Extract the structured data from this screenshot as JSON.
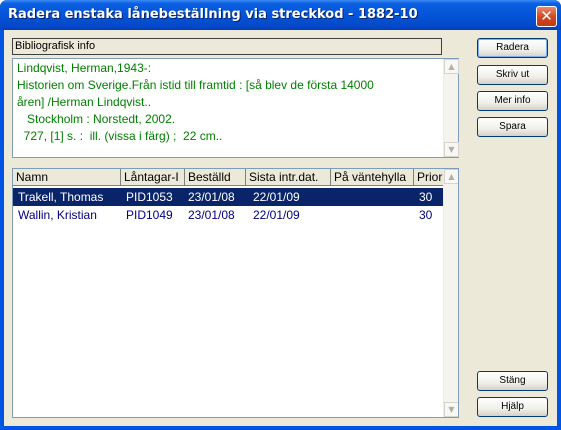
{
  "window": {
    "title": "Radera enstaka lånebeställning via streckkod - 1882-10",
    "close_glyph": "✕"
  },
  "bib": {
    "header": "Bibliografisk info",
    "lines": [
      "Lindqvist, Herman,1943-:",
      "Historien om Sverige.Från istid till framtid : [så blev de första 14000",
      "åren] /Herman Lindqvist..",
      "   Stockholm : Norstedt, 2002.",
      "  727, [1] s. :  ill. (vissa i färg) ;  22 cm.."
    ]
  },
  "list": {
    "columns": [
      "Namn",
      "Låntagar-I",
      "Beställd",
      "Sista intr.dat.",
      "På väntehylla",
      "Prior"
    ],
    "rows": [
      {
        "name": "Trakell, Thomas",
        "patron_id": "PID1053",
        "ordered": "23/01/08",
        "last_date": "22/01/09",
        "on_shelf": "",
        "prio": "30",
        "selected": true
      },
      {
        "name": "Wallin, Kristian",
        "patron_id": "PID1049",
        "ordered": "23/01/08",
        "last_date": "22/01/09",
        "on_shelf": "",
        "prio": "30",
        "selected": false
      }
    ]
  },
  "buttons": {
    "delete": "Radera",
    "print": "Skriv ut",
    "more_info": "Mer info",
    "save": "Spara",
    "close": "Stäng",
    "help": "Hjälp"
  },
  "colors": {
    "title_bar": "#0453d8",
    "selection": "#0a246a",
    "bib_text": "#008000",
    "row_text": "#000080"
  }
}
